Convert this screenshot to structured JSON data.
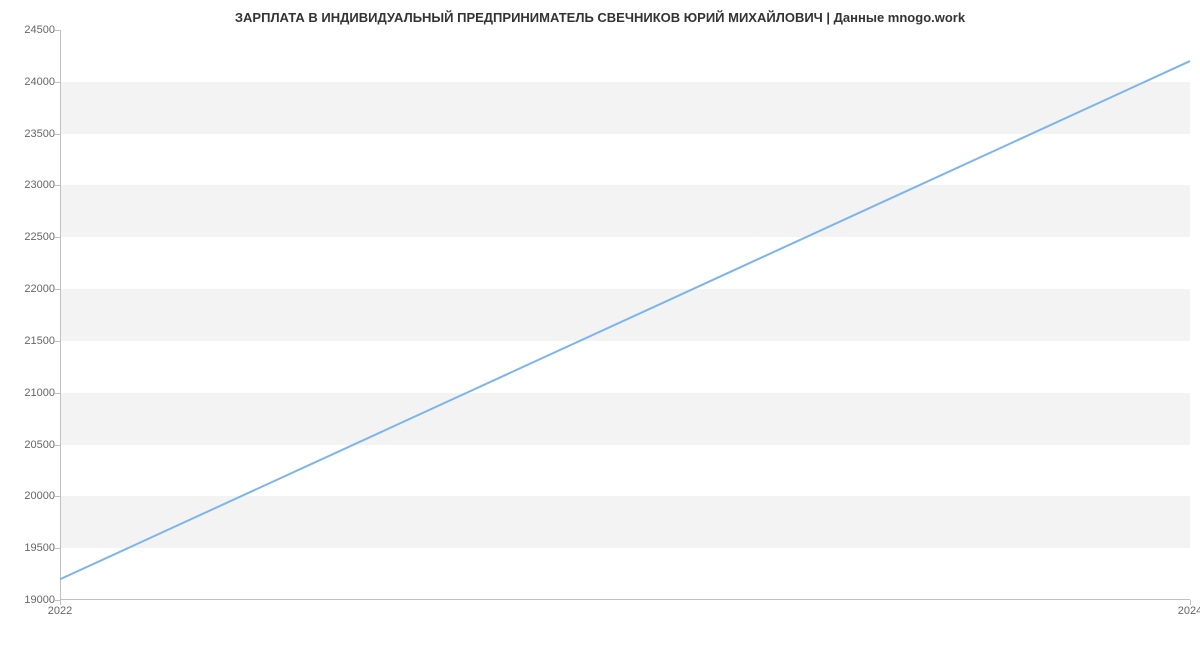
{
  "chart_data": {
    "type": "line",
    "title": "ЗАРПЛАТА В ИНДИВИДУАЛЬНЫЙ ПРЕДПРИНИМАТЕЛЬ СВЕЧНИКОВ ЮРИЙ МИХАЙЛОВИЧ | Данные mnogo.work",
    "x": [
      2022,
      2024
    ],
    "values": [
      19200,
      24200
    ],
    "xlabel": "",
    "ylabel": "",
    "xlim": [
      2022,
      2024
    ],
    "ylim": [
      19000,
      24500
    ],
    "x_ticks": [
      2022,
      2024
    ],
    "y_ticks": [
      19000,
      19500,
      20000,
      20500,
      21000,
      21500,
      22000,
      22500,
      23000,
      23500,
      24000,
      24500
    ],
    "colors": {
      "line": "#7cb5ec",
      "band": "#f3f3f3"
    }
  }
}
